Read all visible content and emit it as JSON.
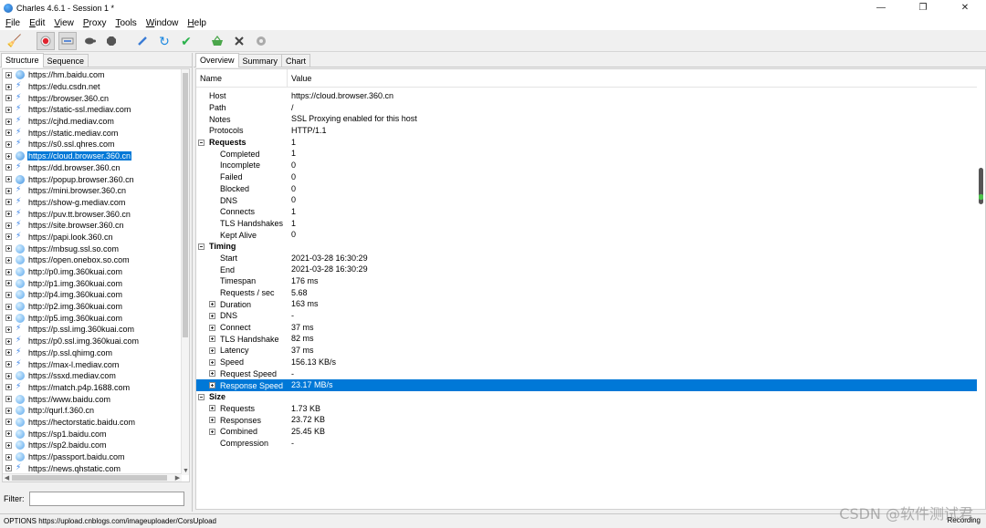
{
  "window": {
    "title": "Charles 4.6.1 - Session 1 *",
    "minimize": "—",
    "maximize": "❐",
    "close": "✕"
  },
  "menu": [
    {
      "key": "F",
      "rest": "ile"
    },
    {
      "key": "E",
      "rest": "dit"
    },
    {
      "key": "V",
      "rest": "iew"
    },
    {
      "key": "P",
      "rest": "roxy"
    },
    {
      "key": "T",
      "rest": "ools"
    },
    {
      "key": "W",
      "rest": "indow"
    },
    {
      "key": "H",
      "rest": "elp"
    }
  ],
  "toolbar": {
    "icons": [
      "broom-icon",
      "record-icon",
      "throttle-icon",
      "turtle-icon",
      "stop-icon",
      "pen-icon",
      "refresh-icon",
      "check-icon",
      "basket-icon",
      "tools-icon",
      "settings-icon"
    ]
  },
  "left": {
    "tabs": [
      "Structure",
      "Sequence"
    ],
    "filter_label": "Filter:",
    "filter_value": "",
    "hosts": [
      {
        "name": "https://hm.baidu.com",
        "icon": "lock"
      },
      {
        "name": "https://edu.csdn.net",
        "icon": "bolt"
      },
      {
        "name": "https://browser.360.cn",
        "icon": "bolt"
      },
      {
        "name": "https://static-ssl.mediav.com",
        "icon": "bolt"
      },
      {
        "name": "https://cjhd.mediav.com",
        "icon": "bolt"
      },
      {
        "name": "https://static.mediav.com",
        "icon": "bolt"
      },
      {
        "name": "https://s0.ssl.qhres.com",
        "icon": "bolt"
      },
      {
        "name": "https://cloud.browser.360.cn",
        "icon": "lock",
        "selected": true
      },
      {
        "name": "https://dd.browser.360.cn",
        "icon": "bolt"
      },
      {
        "name": "https://popup.browser.360.cn",
        "icon": "lock"
      },
      {
        "name": "https://mini.browser.360.cn",
        "icon": "bolt"
      },
      {
        "name": "https://show-g.mediav.com",
        "icon": "bolt"
      },
      {
        "name": "https://puv.tt.browser.360.cn",
        "icon": "bolt"
      },
      {
        "name": "https://site.browser.360.cn",
        "icon": "bolt"
      },
      {
        "name": "https://papi.look.360.cn",
        "icon": "bolt"
      },
      {
        "name": "https://mbsug.ssl.so.com",
        "icon": "plain"
      },
      {
        "name": "https://open.onebox.so.com",
        "icon": "plain"
      },
      {
        "name": "http://p0.img.360kuai.com",
        "icon": "plain"
      },
      {
        "name": "http://p1.img.360kuai.com",
        "icon": "plain"
      },
      {
        "name": "http://p4.img.360kuai.com",
        "icon": "plain"
      },
      {
        "name": "http://p2.img.360kuai.com",
        "icon": "plain"
      },
      {
        "name": "http://p5.img.360kuai.com",
        "icon": "plain"
      },
      {
        "name": "https://p.ssl.img.360kuai.com",
        "icon": "bolt"
      },
      {
        "name": "https://p0.ssl.img.360kuai.com",
        "icon": "bolt"
      },
      {
        "name": "https://p.ssl.qhimg.com",
        "icon": "bolt"
      },
      {
        "name": "https://max-l.mediav.com",
        "icon": "bolt"
      },
      {
        "name": "https://ssxd.mediav.com",
        "icon": "plain"
      },
      {
        "name": "https://match.p4p.1688.com",
        "icon": "bolt"
      },
      {
        "name": "https://www.baidu.com",
        "icon": "plain"
      },
      {
        "name": "http://qurl.f.360.cn",
        "icon": "plain"
      },
      {
        "name": "https://hectorstatic.baidu.com",
        "icon": "plain"
      },
      {
        "name": "https://sp1.baidu.com",
        "icon": "plain"
      },
      {
        "name": "https://sp2.baidu.com",
        "icon": "plain"
      },
      {
        "name": "https://passport.baidu.com",
        "icon": "plain"
      },
      {
        "name": "https://news.qhstatic.com",
        "icon": "bolt"
      }
    ]
  },
  "right": {
    "tabs": [
      "Overview",
      "Summary",
      "Chart"
    ],
    "col_name": "Name",
    "col_value": "Value",
    "rows": [
      {
        "name": "Host",
        "value": "https://cloud.browser.360.cn",
        "level": 0
      },
      {
        "name": "Path",
        "value": "/",
        "level": 0
      },
      {
        "name": "Notes",
        "value": "SSL Proxying enabled for this host",
        "level": 0
      },
      {
        "name": "Protocols",
        "value": "HTTP/1.1",
        "level": 0
      },
      {
        "name": "Requests",
        "value": "1",
        "level": 0,
        "group": true
      },
      {
        "name": "Completed",
        "value": "1",
        "level": 1
      },
      {
        "name": "Incomplete",
        "value": "0",
        "level": 1
      },
      {
        "name": "Failed",
        "value": "0",
        "level": 1
      },
      {
        "name": "Blocked",
        "value": "0",
        "level": 1
      },
      {
        "name": "DNS",
        "value": "0",
        "level": 1
      },
      {
        "name": "Connects",
        "value": "1",
        "level": 1
      },
      {
        "name": "TLS Handshakes",
        "value": "1",
        "level": 1
      },
      {
        "name": "Kept Alive",
        "value": "0",
        "level": 1
      },
      {
        "name": "Timing",
        "value": "",
        "level": 0,
        "group": true
      },
      {
        "name": "Start",
        "value": "2021-03-28 16:30:29",
        "level": 1
      },
      {
        "name": "End",
        "value": "2021-03-28 16:30:29",
        "level": 1
      },
      {
        "name": "Timespan",
        "value": "176 ms",
        "level": 1
      },
      {
        "name": "Requests / sec",
        "value": "5.68",
        "level": 1
      },
      {
        "name": "Duration",
        "value": "163 ms",
        "level": 1,
        "expandable": true
      },
      {
        "name": "DNS",
        "value": "-",
        "level": 1,
        "expandable": true
      },
      {
        "name": "Connect",
        "value": "37 ms",
        "level": 1,
        "expandable": true
      },
      {
        "name": "TLS Handshake",
        "value": "82 ms",
        "level": 1,
        "expandable": true
      },
      {
        "name": "Latency",
        "value": "37 ms",
        "level": 1,
        "expandable": true
      },
      {
        "name": "Speed",
        "value": "156.13 KB/s",
        "level": 1,
        "expandable": true
      },
      {
        "name": "Request Speed",
        "value": "-",
        "level": 1,
        "expandable": true
      },
      {
        "name": "Response Speed",
        "value": "23.17 MB/s",
        "level": 1,
        "expandable": true,
        "selected": true
      },
      {
        "name": "Size",
        "value": "",
        "level": 0,
        "group": true
      },
      {
        "name": "Requests",
        "value": "1.73 KB",
        "level": 1,
        "expandable": true
      },
      {
        "name": "Responses",
        "value": "23.72 KB",
        "level": 1,
        "expandable": true
      },
      {
        "name": "Combined",
        "value": "25.45 KB",
        "level": 1,
        "expandable": true
      },
      {
        "name": "Compression",
        "value": "-",
        "level": 1
      }
    ]
  },
  "status": {
    "left": "OPTIONS https://upload.cnblogs.com/imageuploader/CorsUpload",
    "right": "Recording"
  },
  "watermark": "CSDN @软件测试君",
  "colors": {
    "selection": "#0078d7",
    "scroll_grip": "#4cc34c"
  }
}
